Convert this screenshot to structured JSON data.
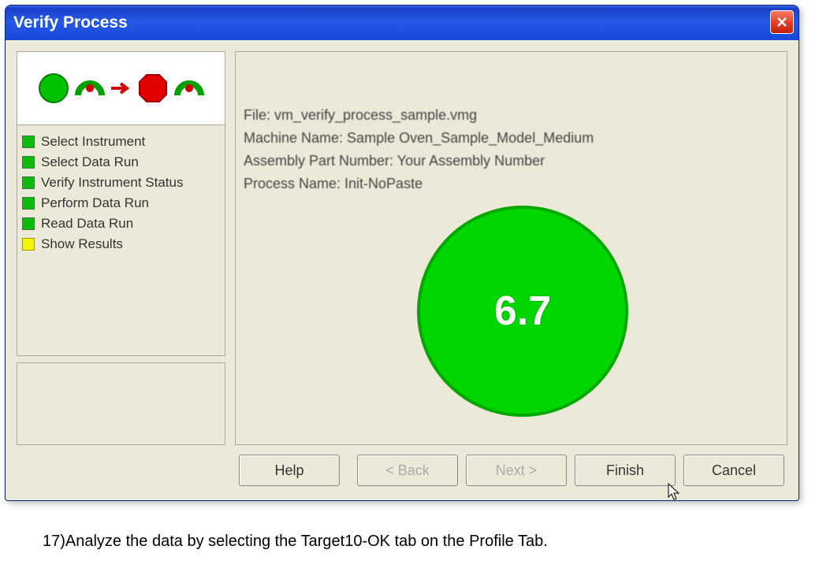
{
  "window": {
    "title": "Verify Process"
  },
  "steps": [
    {
      "label": "Select Instrument",
      "status": "green"
    },
    {
      "label": "Select Data Run",
      "status": "green"
    },
    {
      "label": "Verify Instrument Status",
      "status": "green"
    },
    {
      "label": "Perform Data Run",
      "status": "green"
    },
    {
      "label": "Read Data Run",
      "status": "green"
    },
    {
      "label": "Show Results",
      "status": "yellow"
    }
  ],
  "info": {
    "file": "File: vm_verify_process_sample.vmg",
    "machine": "Machine Name: Sample Oven_Sample_Model_Medium",
    "assembly": "Assembly Part Number: Your Assembly Number",
    "process": "Process Name: Init-NoPaste"
  },
  "result_value": "6.7",
  "buttons": {
    "help": "Help",
    "back": "< Back",
    "next": "Next >",
    "finish": "Finish",
    "cancel": "Cancel"
  },
  "caption": "17)Analyze the data by selecting the Target10-OK tab on the Profile Tab."
}
